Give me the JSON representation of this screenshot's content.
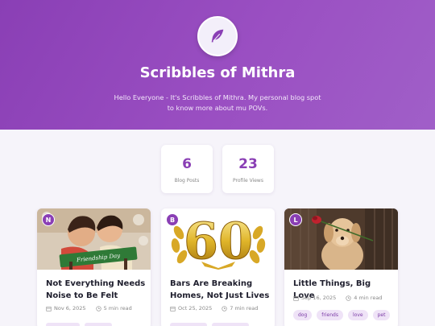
{
  "site": {
    "title": "Scribbles of Mithra",
    "description": "Hello Everyone - It's Scribbles of Mithra. My personal blog spot to know more about mu POVs.",
    "logo_icon": "feather-icon",
    "accent_color": "#8a3fb5"
  },
  "stats": [
    {
      "value": "6",
      "label": "Blog Posts"
    },
    {
      "value": "23",
      "label": "Profile Views"
    }
  ],
  "posts": [
    {
      "initial": "N",
      "title": "Not Everything Needs Noise to Be Felt",
      "date": "Nov 6, 2025",
      "read_time": "5 min read",
      "tags": [
        "",
        ""
      ],
      "image": "friendship-day-photo"
    },
    {
      "initial": "B",
      "title": "Bars Are Breaking Homes, Not Just Lives",
      "date": "Oct 25, 2025",
      "read_time": "7 min read",
      "tags": [
        "",
        ""
      ],
      "image": "golden-60-photo"
    },
    {
      "initial": "L",
      "title": "Little Things, Big Love",
      "date": "Sep 16, 2025",
      "read_time": "4 min read",
      "tags": [
        "dog",
        "friends",
        "love",
        "pet"
      ],
      "image": "puppy-with-rose-photo"
    }
  ],
  "image_text": {
    "friendship_sign": "Friendship Day",
    "golden_number": "60"
  }
}
